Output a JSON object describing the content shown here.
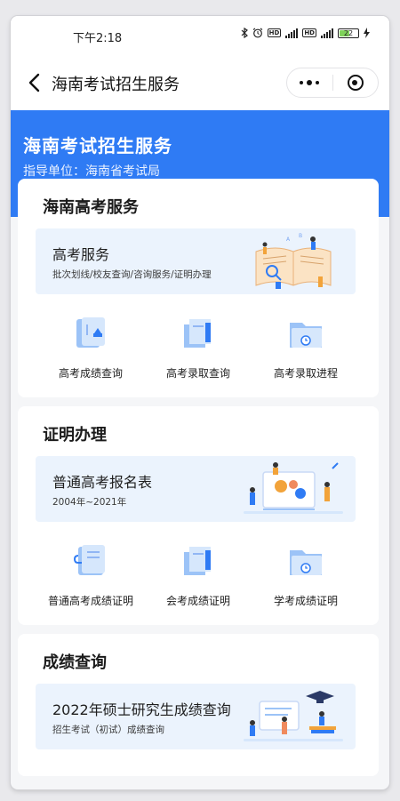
{
  "status_bar": {
    "time": "下午2:18",
    "battery_level": "22"
  },
  "nav": {
    "title": "海南考试招生服务"
  },
  "banner": {
    "title": "海南考试招生服务",
    "subtitle": "指导单位：海南省考试局"
  },
  "sections": [
    {
      "title": "海南高考服务",
      "feature": {
        "title": "高考服务",
        "subtitle": "批次划线/校友查询/咨询服务/证明办理"
      },
      "items": [
        {
          "label": "高考成绩查询",
          "icon": "score-card-icon"
        },
        {
          "label": "高考录取查询",
          "icon": "document-stack-icon"
        },
        {
          "label": "高考录取进程",
          "icon": "folder-clock-icon"
        }
      ]
    },
    {
      "title": "证明办理",
      "feature": {
        "title": "普通高考报名表",
        "subtitle": "2004年~2021年"
      },
      "items": [
        {
          "label": "普通高考成绩证明",
          "icon": "clip-document-icon"
        },
        {
          "label": "会考成绩证明",
          "icon": "document-stack-icon"
        },
        {
          "label": "学考成绩证明",
          "icon": "folder-clock-icon"
        }
      ]
    },
    {
      "title": "成绩查询",
      "feature": {
        "title": "2022年硕士研究生成绩查询",
        "subtitle": "招生考试（初试）成绩查询"
      }
    }
  ],
  "colors": {
    "primary": "#2f7bf4",
    "feature_bg": "#ebf3fd",
    "page_bg": "#f5f6f8"
  }
}
